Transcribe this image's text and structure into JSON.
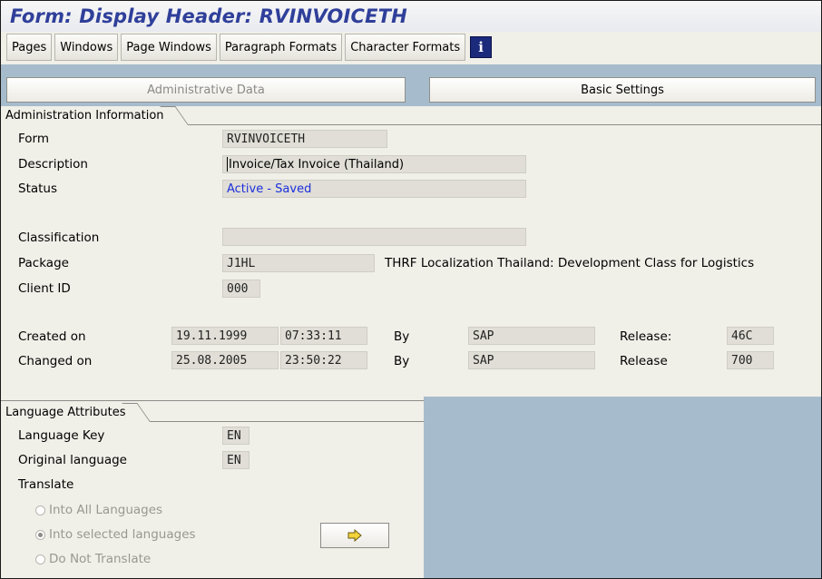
{
  "title": "Form: Display Header: RVINVOICETH",
  "toolbar": {
    "pages": "Pages",
    "windows": "Windows",
    "page_windows": "Page Windows",
    "paragraph_formats": "Paragraph Formats",
    "character_formats": "Character Formats",
    "info_icon": "info-icon"
  },
  "tabs": {
    "admin": "Administrative Data",
    "basic": "Basic Settings"
  },
  "admin_info": {
    "header": "Administration Information",
    "form_label": "Form",
    "form_value": "RVINVOICETH",
    "description_label": "Description",
    "description_value": "Invoice/Tax Invoice (Thailand)",
    "status_label": "Status",
    "status_value": "Active - Saved",
    "classification_label": "Classification",
    "classification_value": "",
    "package_label": "Package",
    "package_value": "J1HL",
    "package_desc": "THRF  Localization Thailand: Development Class for Logistics",
    "client_label": "Client ID",
    "client_value": "000",
    "created_label": "Created on",
    "created_date": "19.11.1999",
    "created_time": "07:33:11",
    "created_by_label": "By",
    "created_by": "SAP",
    "created_release_label": "Release:",
    "created_release": "46C",
    "changed_label": "Changed on",
    "changed_date": "25.08.2005",
    "changed_time": "23:50:22",
    "changed_by_label": "By",
    "changed_by": "SAP",
    "changed_release_label": "Release",
    "changed_release": "700"
  },
  "language": {
    "header": "Language Attributes",
    "key_label": "Language Key",
    "key_value": "EN",
    "original_label": "Original language",
    "original_value": "EN",
    "translate_label": "Translate",
    "radio_all": "Into All Languages",
    "radio_selected": "Into selected languages",
    "radio_none": "Do Not Translate",
    "selected_option": "Into selected languages",
    "arrow_icon": "arrow-right-icon"
  },
  "colors": {
    "title": "#2f3f9a",
    "status": "#1c2fdc",
    "band": "#a6bccd",
    "panel": "#f0efe8"
  }
}
